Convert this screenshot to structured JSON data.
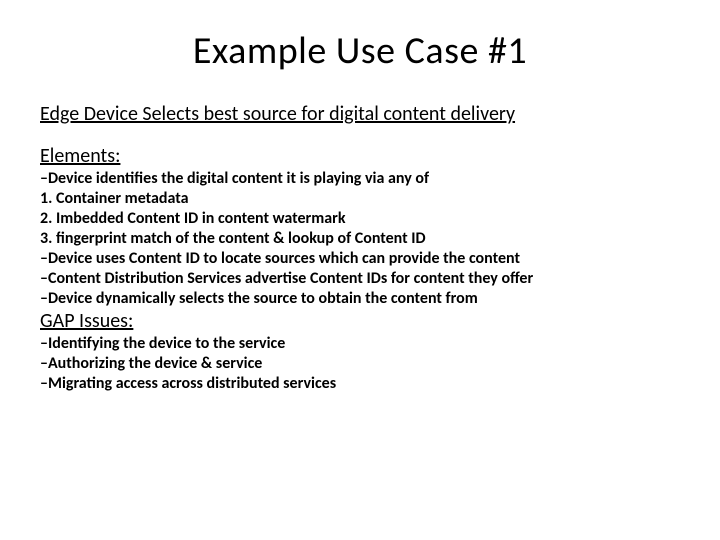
{
  "title": "Example Use Case #1",
  "subtitle": "Edge Device Selects best source for digital content delivery",
  "elements_label": "Elements:",
  "elements_lines": [
    "–Device identifies the digital content it is playing via any of",
    "1. Container metadata",
    "2. Imbedded Content ID in content watermark",
    "3. fingerprint match of the content & lookup of Content ID",
    "–Device uses Content ID to locate sources which can provide the content",
    "–Content Distribution Services advertise Content IDs for content they offer",
    "–Device dynamically selects the source to obtain the content from"
  ],
  "gap_label": "GAP Issues:",
  "gap_lines": [
    "–Identifying the device to the service",
    "–Authorizing the device & service",
    "–Migrating access across distributed services"
  ]
}
